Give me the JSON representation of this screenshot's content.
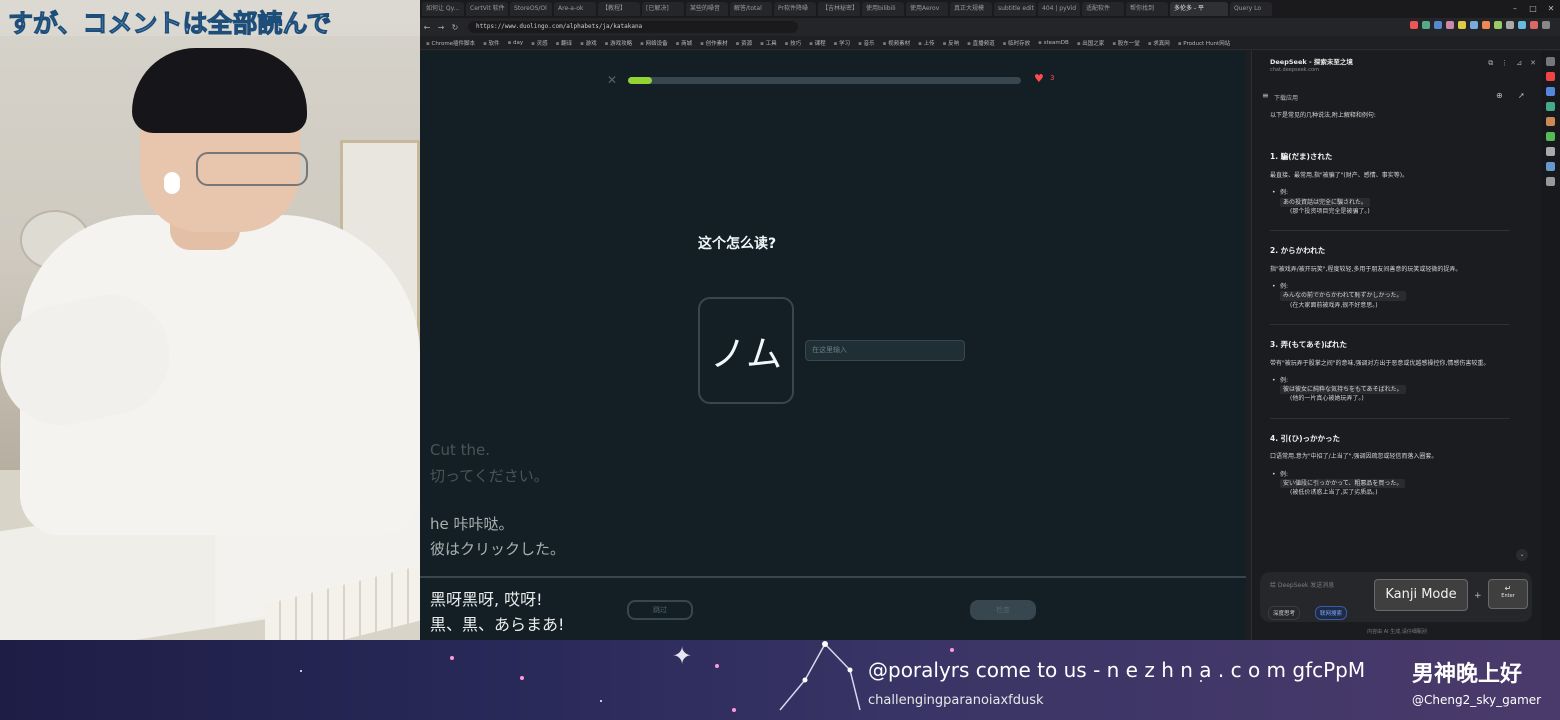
{
  "overlay_text": "すが、コメントは全部読んで",
  "browser": {
    "tabs": [
      "如何让 Qy...",
      "CertVit 软件",
      "StoreOS/Ol",
      "Are-a-ok",
      "【教程】",
      "[已解决]",
      "某些的噪音",
      "解答/total",
      "Pr软件降噪",
      "【吉林秘密】",
      "使用bilibili",
      "使用Aerov",
      "真正大规模",
      "subtitle edit",
      "404 | pyVid",
      "适配软件",
      "帮你找到",
      "多伦多 - 平",
      "Query Lo"
    ],
    "active_tab": "多伦多 - 平",
    "url": "https://www.duolingo.com/alphabets/ja/katakana",
    "bookmarks": [
      "Chrome插件脚本",
      "软件",
      "day",
      "灵感",
      "翻译",
      "游戏",
      "游戏攻略",
      "网络设备",
      "商城",
      "创作素材",
      "资源",
      "工具",
      "技巧",
      "课程",
      "学习",
      "音乐",
      "视频素材",
      "上传",
      "反响",
      "直播频道",
      "临时存放",
      "steamDB",
      "出国之家",
      "股东一堂",
      "求真网",
      "Product Hunt网站"
    ]
  },
  "duolingo": {
    "progress": 0.06,
    "hearts": "3",
    "question": "这个怎么读?",
    "character": "ノム",
    "input_placeholder": "在这里输入",
    "skip_label": "跳过",
    "check_label": "检查"
  },
  "subtitles": {
    "line1": "Cut the.",
    "line2": "切ってください。",
    "line3": "he 咔咔哒。",
    "line4": "彼はクリックした。",
    "line5": "黑呀黑呀, 哎呀!",
    "line6": "黒、黒、あらまあ!"
  },
  "deepseek": {
    "title": "DeepSeek - 探索未至之境",
    "url": "chat.deepseek.com",
    "download_app": "下载应用",
    "intro": "以下是常见的几种说法,附上解释和例句:",
    "items": [
      {
        "heading": "1. 騙(だま)された",
        "desc": "最直接、最常用,指\"被骗了\"(财产、感情、事实等)。",
        "example_label": "例:",
        "example_jp": "あの投資話は完全に騙された。",
        "example_cn": "(那个投资项目完全是被骗了。)"
      },
      {
        "heading": "2. からかわれた",
        "desc": "指\"被戏弄/被开玩笑\",程度较轻,多用于朋友间善意的玩笑或轻微的捉弄。",
        "example_label": "例:",
        "example_jp": "みんなの前でからかわれて恥ずかしかった。",
        "example_cn": "(在大家面前被戏弄,很不好意思。)"
      },
      {
        "heading": "3. 弄(もてあそ)ばれた",
        "desc": "带有\"被玩弄于股掌之间\"的意味,强调对方出于恶意或优越感操控你,情感伤害较重。",
        "example_label": "例:",
        "example_jp": "彼は彼女に純粋な気持ちをもてあそばれた。",
        "example_cn": "(他的一片真心被她玩弄了。)"
      },
      {
        "heading": "4. 引(ひ)っかかった",
        "desc": "口语常用,意为\"中招了/上当了\",强调因疏忽或轻信而落入圈套。",
        "example_label": "例:",
        "example_jp": "安い値段に引っかかって、粗悪品を買った。",
        "example_cn": "(被低价诱惑上当了,买了劣质品。)"
      }
    ],
    "input_placeholder": "给 DeepSeek 发送消息",
    "deep_think": "深度思考",
    "web_search": "联网搜索",
    "footer": "内容由 AI 生成,请仔细甄别"
  },
  "key_overlay": {
    "kanji_mode": "Kanji Mode",
    "plus": "+",
    "enter_symbol": "↵",
    "enter_label": "Enter"
  },
  "banner": {
    "main_text": "@poralyrs come to us - n e z h n a . c o m gfcPpM",
    "username": "challengingparanoiaxfdusk",
    "greeting": "男神晚上好",
    "handle": "@Cheng2_sky_gamer"
  },
  "colors": {
    "duo_bg": "#131f24",
    "progress_green": "#93d333",
    "heart_red": "#ff4b4b",
    "panel_bg": "#1b1c1f"
  }
}
